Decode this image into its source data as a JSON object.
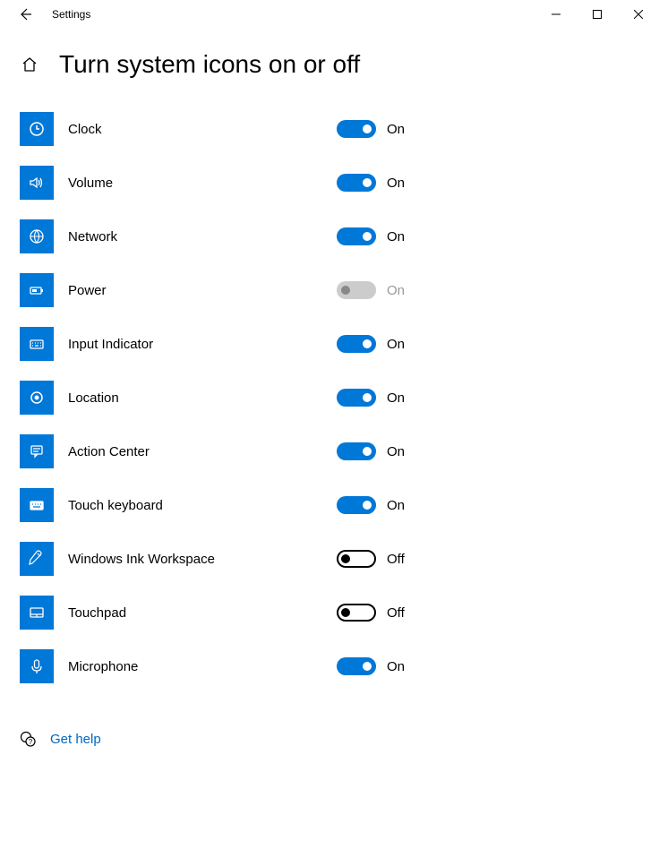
{
  "window": {
    "app_title": "Settings"
  },
  "page": {
    "title": "Turn system icons on or off"
  },
  "toggle_labels": {
    "on": "On",
    "off": "Off"
  },
  "items": [
    {
      "id": "clock",
      "label": "Clock",
      "state": "on",
      "icon": "clock-icon"
    },
    {
      "id": "volume",
      "label": "Volume",
      "state": "on",
      "icon": "volume-icon"
    },
    {
      "id": "network",
      "label": "Network",
      "state": "on",
      "icon": "network-icon"
    },
    {
      "id": "power",
      "label": "Power",
      "state": "disabled",
      "icon": "power-icon"
    },
    {
      "id": "input",
      "label": "Input Indicator",
      "state": "on",
      "icon": "keyboard-icon"
    },
    {
      "id": "location",
      "label": "Location",
      "state": "on",
      "icon": "location-icon"
    },
    {
      "id": "action",
      "label": "Action Center",
      "state": "on",
      "icon": "action-center-icon"
    },
    {
      "id": "touchkb",
      "label": "Touch keyboard",
      "state": "on",
      "icon": "touch-keyboard-icon"
    },
    {
      "id": "ink",
      "label": "Windows Ink Workspace",
      "state": "off",
      "icon": "ink-icon"
    },
    {
      "id": "touchpad",
      "label": "Touchpad",
      "state": "off",
      "icon": "touchpad-icon"
    },
    {
      "id": "mic",
      "label": "Microphone",
      "state": "on",
      "icon": "microphone-icon"
    }
  ],
  "help": {
    "label": "Get help"
  }
}
